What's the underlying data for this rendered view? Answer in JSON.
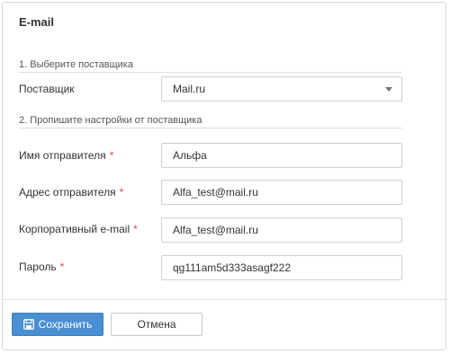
{
  "dialog": {
    "title": "E-mail"
  },
  "section1": {
    "title": "1. Выберите поставщика"
  },
  "provider": {
    "label": "Поставщик",
    "value": "Mail.ru"
  },
  "section2": {
    "title": "2. Пропишите настройки от поставщика"
  },
  "fields": {
    "sender_name": {
      "label": "Имя отправителя",
      "required_mark": "*",
      "value": "Альфа"
    },
    "sender_address": {
      "label": "Адрес отправителя",
      "required_mark": "*",
      "value": "Alfa_test@mail.ru"
    },
    "corporate_email": {
      "label": "Корпоративный e-mail",
      "required_mark": "*",
      "value": "Alfa_test@mail.ru"
    },
    "password": {
      "label": "Пароль",
      "required_mark": "*",
      "value": "qg111am5d333asagf222"
    }
  },
  "buttons": {
    "save_label": "Сохранить",
    "cancel_label": "Отмена"
  },
  "icons": {
    "save": "floppy-disk-icon",
    "caret": "chevron-down-icon"
  },
  "colors": {
    "primary": "#4a8fd1",
    "required": "#e04646"
  }
}
